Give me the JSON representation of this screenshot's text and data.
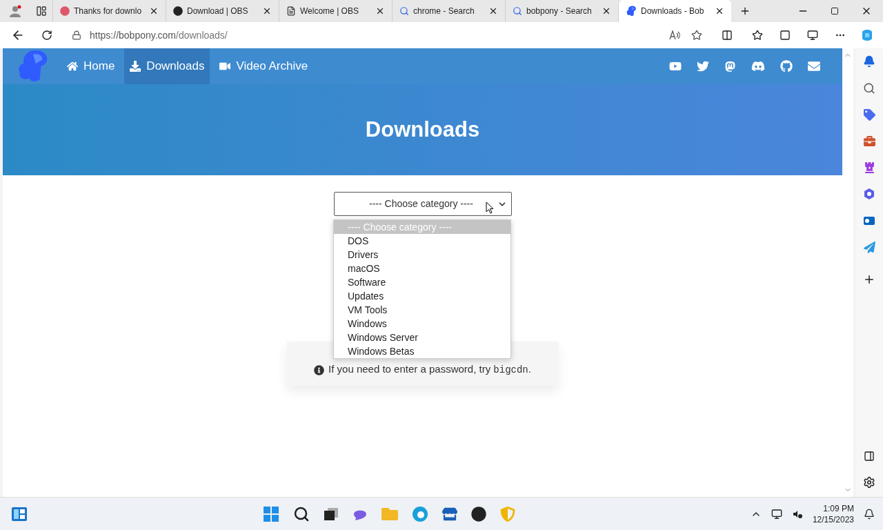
{
  "tabs": [
    {
      "title": "Thanks for downlo",
      "kind": "ring",
      "selected": false
    },
    {
      "title": "Download | OBS",
      "kind": "disc",
      "selected": false
    },
    {
      "title": "Welcome | OBS",
      "kind": "page",
      "selected": false
    },
    {
      "title": "chrome - Search",
      "kind": "search",
      "selected": false
    },
    {
      "title": "bobpony - Search",
      "kind": "search",
      "selected": false
    },
    {
      "title": "Downloads - Bob",
      "kind": "pony",
      "selected": true
    }
  ],
  "address_bar": {
    "url_host": "https://bobpony.com",
    "url_path": "/downloads/"
  },
  "nav": [
    {
      "label": "Home",
      "kind": "home",
      "selected": false
    },
    {
      "label": "Downloads",
      "kind": "download",
      "selected": true
    },
    {
      "label": "Video Archive",
      "kind": "video",
      "selected": false
    }
  ],
  "hero": {
    "title": "Downloads"
  },
  "category_select": {
    "value": "---- Choose category ----"
  },
  "category_options": [
    {
      "label": "---- Choose category ----",
      "selected": true
    },
    {
      "label": "DOS",
      "selected": false
    },
    {
      "label": "Drivers",
      "selected": false
    },
    {
      "label": "macOS",
      "selected": false
    },
    {
      "label": "Software",
      "selected": false
    },
    {
      "label": "Updates",
      "selected": false
    },
    {
      "label": "VM Tools",
      "selected": false
    },
    {
      "label": "Windows",
      "selected": false
    },
    {
      "label": "Windows Server",
      "selected": false
    },
    {
      "label": "Windows Betas",
      "selected": false
    }
  ],
  "info": {
    "text": "If you need to enter a password, try",
    "code": "bigcdn",
    "after": "."
  },
  "taskbar": {
    "time": "1:09 PM",
    "date": "12/15/2023"
  }
}
